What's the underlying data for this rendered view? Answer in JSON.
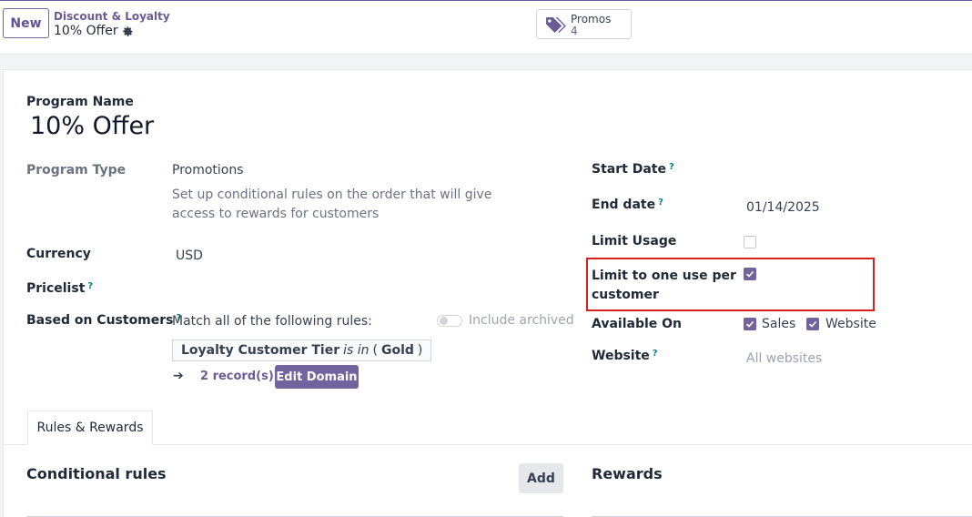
{
  "header": {
    "new_label": "New",
    "breadcrumb": "Discount & Loyalty",
    "record_title": "10% Offer",
    "promos_label": "Promos",
    "promos_count": "4"
  },
  "form": {
    "program_name_label": "Program Name",
    "program_name_value": "10% Offer",
    "program_type_label": "Program Type",
    "program_type_value": "Promotions",
    "program_type_help": "Set up conditional rules on the order that will give access to rewards for customers",
    "currency_label": "Currency",
    "currency_value": "USD",
    "pricelist_label": "Pricelist",
    "based_on_label": "Based on Customers",
    "match_text": "Match all of the following rules:",
    "include_archived": "Include archived",
    "domain_field": "Loyalty Customer Tier",
    "domain_op": "is in",
    "domain_open": "(",
    "domain_value": "Gold",
    "domain_close": ")",
    "records_count": "2 record(s)",
    "edit_domain": "Edit Domain",
    "help_mark": "?",
    "start_date_label": "Start Date",
    "end_date_label": "End date",
    "end_date_value": "01/14/2025",
    "limit_usage_label": "Limit Usage",
    "limit_usage_checked": false,
    "limit_one_use_label_1": "Limit to one use per",
    "limit_one_use_label_2": "customer",
    "limit_one_use_checked": true,
    "available_on_label": "Available On",
    "available_sales": "Sales",
    "available_website": "Website",
    "website_label": "Website",
    "website_placeholder": "All websites"
  },
  "tabs": {
    "rules_rewards": "Rules & Rewards"
  },
  "sections": {
    "conditional_rules": "Conditional rules",
    "add_label": "Add",
    "rewards": "Rewards"
  },
  "colors": {
    "accent": "#71639e",
    "highlight_border": "#d61f1f"
  }
}
